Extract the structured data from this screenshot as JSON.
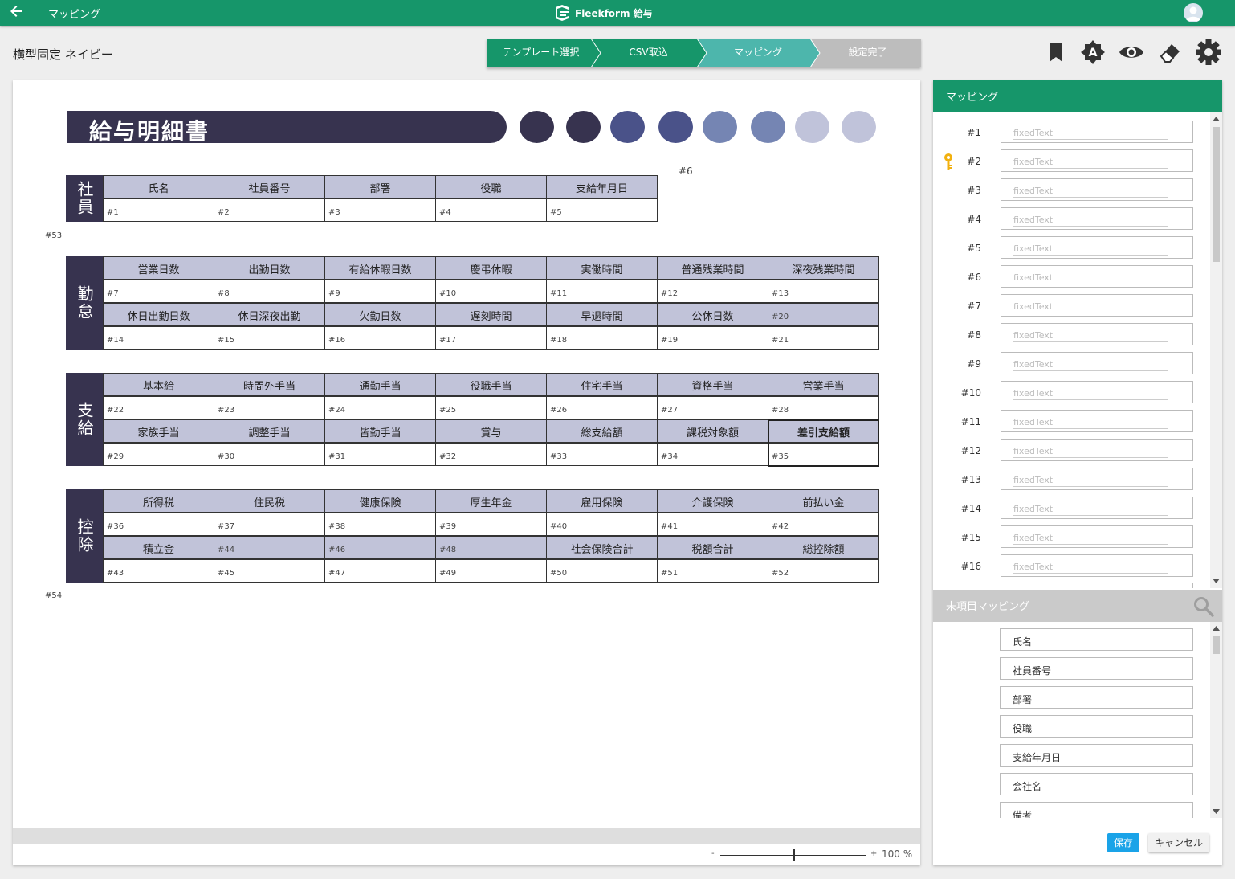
{
  "header": {
    "page_title": "マッピング",
    "brand": "Fleekform 給与",
    "back_icon": "arrow-left-icon",
    "avatar_icon": "user-avatar-icon"
  },
  "doc_title": "横型固定 ネイビー",
  "steps": [
    {
      "label": "テンプレート選択",
      "state": "done",
      "color": "#16966a"
    },
    {
      "label": "CSV取込",
      "state": "done",
      "color": "#16966a"
    },
    {
      "label": "マッピング",
      "state": "current",
      "color": "#4db6ac"
    },
    {
      "label": "設定完了",
      "state": "todo",
      "color": "#bdbdbd"
    }
  ],
  "toolbar_icons": [
    "bookmark-icon",
    "brightness-auto-icon",
    "eye-icon",
    "eraser-icon",
    "gear-icon"
  ],
  "payslip": {
    "title": "給与明細書",
    "dot_colors": [
      "#37334f",
      "#37334f",
      "#4a5289",
      "#4a5289",
      "#7585b3",
      "#7585b3",
      "#c0c3da",
      "#c0c3da"
    ],
    "markers": {
      "m6": "#6",
      "m53": "#53",
      "m54": "#54"
    },
    "employee": {
      "label": "社員",
      "headers": [
        "氏名",
        "社員番号",
        "部署",
        "役職",
        "支給年月日"
      ],
      "values": [
        "#1",
        "#2",
        "#3",
        "#4",
        "#5"
      ]
    },
    "attendance": {
      "label": "勤怠",
      "row1_headers": [
        "営業日数",
        "出勤日数",
        "有給休暇日数",
        "慶弔休暇",
        "実働時間",
        "普通残業時間",
        "深夜残業時間"
      ],
      "row1_values": [
        "#7",
        "#8",
        "#9",
        "#10",
        "#11",
        "#12",
        "#13"
      ],
      "row2_headers": [
        "休日出勤日数",
        "休日深夜出勤",
        "欠勤日数",
        "遅刻時間",
        "早退時間",
        "公休日数",
        "#20"
      ],
      "row2_values": [
        "#14",
        "#15",
        "#16",
        "#17",
        "#18",
        "#19",
        "#21"
      ]
    },
    "payment": {
      "label": "支給",
      "row1_headers": [
        "基本給",
        "時間外手当",
        "通勤手当",
        "役職手当",
        "住宅手当",
        "資格手当",
        "営業手当"
      ],
      "row1_values": [
        "#22",
        "#23",
        "#24",
        "#25",
        "#26",
        "#27",
        "#28"
      ],
      "row2_headers": [
        "家族手当",
        "調整手当",
        "皆勤手当",
        "賞与",
        "総支給額",
        "課税対象額",
        "差引支給額"
      ],
      "row2_values": [
        "#29",
        "#30",
        "#31",
        "#32",
        "#33",
        "#34",
        "#35"
      ]
    },
    "deduction": {
      "label": "控除",
      "row1_headers": [
        "所得税",
        "住民税",
        "健康保険",
        "厚生年金",
        "雇用保険",
        "介護保険",
        "前払い金"
      ],
      "row1_values": [
        "#36",
        "#37",
        "#38",
        "#39",
        "#40",
        "#41",
        "#42"
      ],
      "row2_headers": [
        "積立金",
        "#44",
        "#46",
        "#48",
        "社会保険合計",
        "税額合計",
        "総控除額"
      ],
      "row2_values": [
        "#43",
        "#45",
        "#47",
        "#49",
        "#50",
        "#51",
        "#52"
      ]
    }
  },
  "zoom": {
    "minus": "-",
    "plus": "+",
    "value_text": "100 %",
    "level": 0.5
  },
  "panel": {
    "mapping_title": "マッピング",
    "placeholder": "fixedText",
    "rows": [
      "#1",
      "#2",
      "#3",
      "#4",
      "#5",
      "#6",
      "#7",
      "#8",
      "#9",
      "#10",
      "#11",
      "#12",
      "#13",
      "#14",
      "#15",
      "#16"
    ],
    "unmapped_title": "未項目マッピング",
    "unmapped_items": [
      "氏名",
      "社員番号",
      "部署",
      "役職",
      "支給年月日",
      "会社名",
      "備考"
    ],
    "save_label": "保存",
    "cancel_label": "キャンセル"
  }
}
